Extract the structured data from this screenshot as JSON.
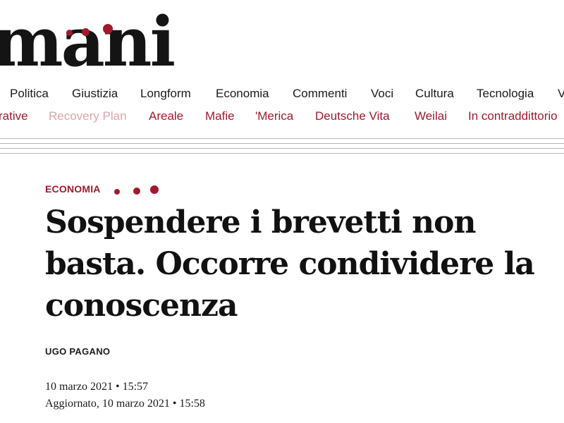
{
  "brand": {
    "logo_text": "mani",
    "accent_color": "#a2192c"
  },
  "nav": {
    "primary": [
      "Politica",
      "Giustizia",
      "Longform",
      "Economia",
      "Commenti",
      "Voci",
      "Cultura",
      "Tecnologia",
      "V"
    ],
    "secondary": [
      "rative",
      "Recovery Plan",
      "Areale",
      "Mafie",
      "'Merica",
      "Deutsche Vita",
      "Weilai",
      "In contraddittorio"
    ]
  },
  "article": {
    "section": "ECONOMIA",
    "title": "Sospendere i brevetti non basta. Occorre condividere la conoscenza",
    "author": "UGO PAGANO",
    "published": "10 marzo 2021 • 15:57",
    "updated": "Aggiornato, 10 marzo 2021 • 15:58"
  }
}
